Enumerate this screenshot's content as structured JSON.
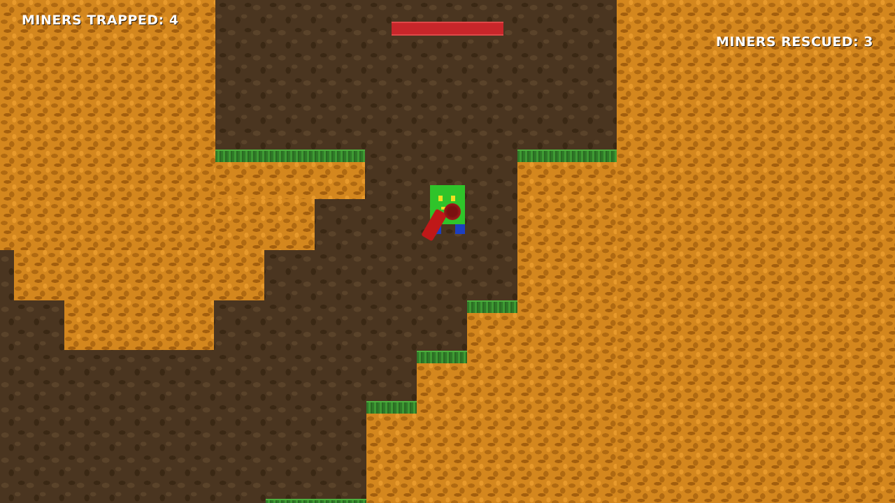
{
  "hud": {
    "miners_trapped_label": "MINERS TRAPPED: 4",
    "miners_rescued_label": "MINERS RESCUED: 3"
  },
  "health": {
    "fraction": 1.0
  },
  "colors": {
    "rock": "#d4871e",
    "dirt_background": "#4a3520",
    "grass": "#3e9a33",
    "player_body": "#2fc42a",
    "player_feet": "#1c3fc0",
    "player_tool": "#c01818",
    "health_bar": "#c8262a"
  },
  "icons": {
    "player": "green-miner-robot",
    "tool": "red-drill"
  }
}
